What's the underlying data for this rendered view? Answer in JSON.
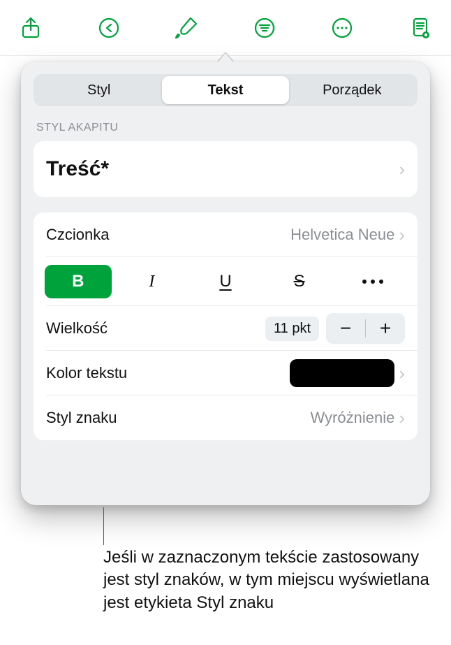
{
  "segments": {
    "style": "Styl",
    "text": "Tekst",
    "order": "Porządek"
  },
  "sections": {
    "paragraph_style": "STYL AKAPITU"
  },
  "paragraph": {
    "name": "Treść*"
  },
  "font": {
    "label": "Czcionka",
    "value": "Helvetica Neue"
  },
  "format_buttons": {
    "bold": "B",
    "italic": "I",
    "underline": "U",
    "strike": "S"
  },
  "size": {
    "label": "Wielkość",
    "value": "11 pkt"
  },
  "text_color": {
    "label": "Kolor tekstu",
    "hex": "#000000"
  },
  "char_style": {
    "label": "Styl znaku",
    "value": "Wyróżnienie"
  },
  "caption": "Jeśli w zaznaczonym tekście zastosowany jest styl znaków, w tym miejscu wyświetlana jest etykieta Styl znaku"
}
